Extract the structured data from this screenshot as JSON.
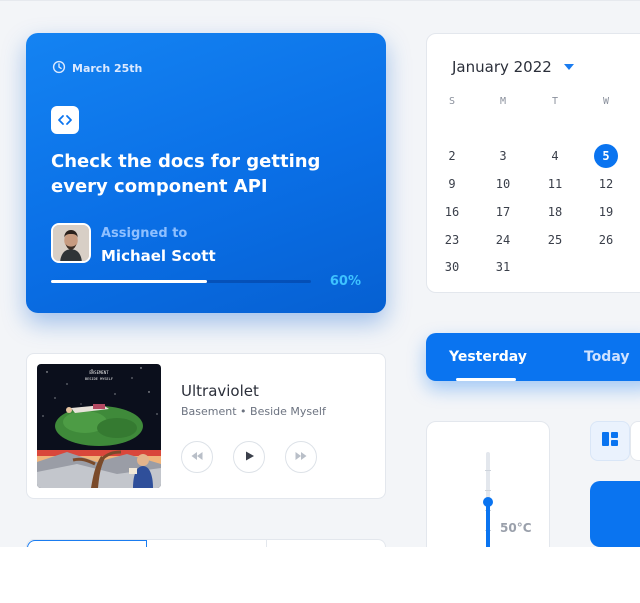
{
  "task": {
    "date": "March 25th",
    "title": "Check the docs for getting every component API",
    "assigned_label": "Assigned to",
    "assignee": "Michael Scott",
    "progress": 0.6,
    "progress_text": "60%",
    "icons": [
      "clock-icon",
      "code-icon"
    ]
  },
  "music": {
    "title": "Ultraviolet",
    "meta": "Basement • Beside Myself",
    "album_text": [
      "BASEMENT",
      "BESIDE MYSELF"
    ],
    "controls": [
      "rewind-icon",
      "play-icon",
      "fast-forward-icon"
    ]
  },
  "calendar": {
    "month_label": "January 2022",
    "weekdays": [
      "S",
      "M",
      "T",
      "W"
    ],
    "weeks": [
      [
        "",
        "",
        "",
        ""
      ],
      [
        "2",
        "3",
        "4",
        "5"
      ],
      [
        "9",
        "10",
        "11",
        "12"
      ],
      [
        "16",
        "17",
        "18",
        "19"
      ],
      [
        "23",
        "24",
        "25",
        "26"
      ],
      [
        "30",
        "31",
        "",
        ""
      ]
    ],
    "selected": "5"
  },
  "period": {
    "active": "Yesterday",
    "other": "Today"
  },
  "temperature": {
    "value": "50°C",
    "level": 0.5
  },
  "colors": {
    "accent": "#0a74f0",
    "progress_text": "#3ec3ff",
    "background": "#f3f5f8"
  }
}
